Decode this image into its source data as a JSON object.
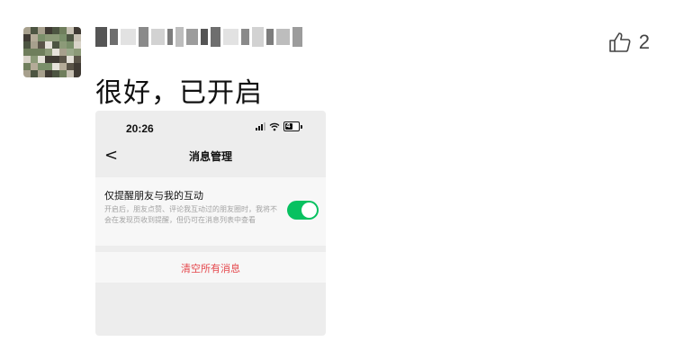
{
  "comment": {
    "text": "很好，已开启",
    "like_count": "2",
    "like_icon": "thumbs-up-outline-icon"
  },
  "screenshot": {
    "status_bar": {
      "time": "20:26",
      "battery_level": "4"
    },
    "nav": {
      "back_glyph": "<",
      "title": "消息管理"
    },
    "setting": {
      "title": "仅提醒朋友与我的互动",
      "description": "开启后，朋友点赞、评论我互动过的朋友圈时，我将不会在发现页收到提醒，但仍可在消息列表中查看",
      "enabled": true
    },
    "clear_action": {
      "label": "清空所有消息",
      "color": "#e5484d"
    }
  },
  "colors": {
    "toggle_on": "#07c160",
    "screenshot_bg": "#ededed"
  }
}
